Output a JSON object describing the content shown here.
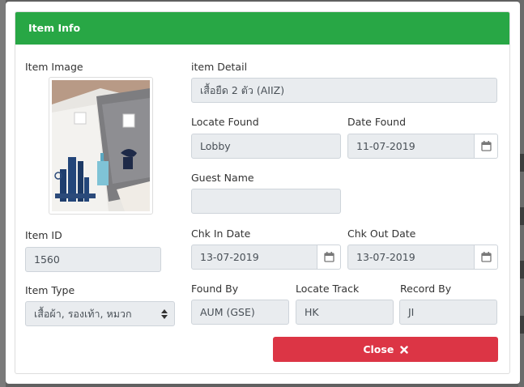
{
  "modal": {
    "title": "Item Info",
    "close_label": "Close",
    "close_icon": "times-icon"
  },
  "left": {
    "image_label": "Item Image",
    "image_icon": "folded-shirts-photo",
    "item_id_label": "Item ID",
    "item_id_value": "1560",
    "item_type_label": "Item Type",
    "item_type_value": "เสื้อผ้า, รองเท้า, หมวก"
  },
  "detail": {
    "label": "item Detail",
    "value": "เสื้อยืด 2 ตัว (AIIZ)"
  },
  "locate_found": {
    "label": "Locate Found",
    "value": "Lobby"
  },
  "date_found": {
    "label": "Date Found",
    "value": "11-07-2019"
  },
  "guest_name": {
    "label": "Guest Name",
    "value": ""
  },
  "chk_in": {
    "label": "Chk In Date",
    "value": "13-07-2019"
  },
  "chk_out": {
    "label": "Chk Out Date",
    "value": "13-07-2019"
  },
  "found_by": {
    "label": "Found By",
    "value": "AUM (GSE)"
  },
  "locate_track": {
    "label": "Locate Track",
    "value": "HK"
  },
  "record_by": {
    "label": "Record By",
    "value": "JI"
  },
  "colors": {
    "header": "#28a745",
    "close_button": "#dc3545",
    "field_bg": "#e9ecef"
  }
}
